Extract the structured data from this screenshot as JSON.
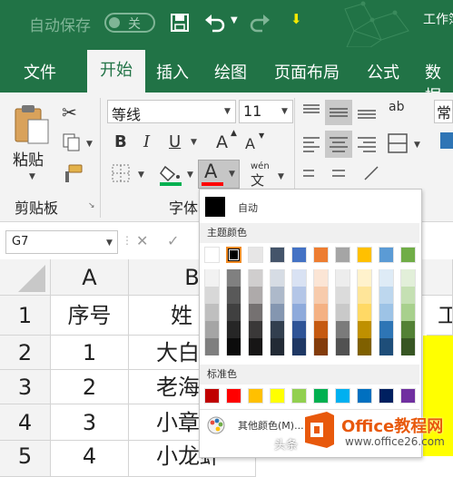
{
  "titlebar": {
    "autosave_label": "自动保存",
    "autosave_state": "关",
    "window_title": "工作簿"
  },
  "tabs": [
    "文件",
    "开始",
    "插入",
    "绘图",
    "页面布局",
    "公式",
    "数据"
  ],
  "active_tab": "开始",
  "ribbon": {
    "paste_label": "粘贴",
    "clipboard_group": "剪贴板",
    "font_group": "字体",
    "font_name": "等线",
    "font_size": "11",
    "bold": "B",
    "italic": "I",
    "underline": "U",
    "grow_font": "A",
    "shrink_font": "A",
    "font_color_glyph": "A",
    "phonetic_top": "wén",
    "phonetic_bottom": "文",
    "orientation_glyph": "ab",
    "number_format_partial": "常"
  },
  "formula_bar": {
    "name_box": "G7",
    "cancel": "✕",
    "confirm": "✓"
  },
  "sheet": {
    "column_headers": [
      "A",
      "B"
    ],
    "row_headers": [
      "1",
      "2",
      "3",
      "4",
      "5"
    ],
    "col_a": [
      "序号",
      "1",
      "2",
      "3",
      "4"
    ],
    "col_b": [
      "姓",
      "大白",
      "老海",
      "小章",
      "小龙虾"
    ],
    "col_f_partial": "工"
  },
  "color_menu": {
    "auto_label": "自动",
    "theme_label": "主题颜色",
    "standard_label": "标准色",
    "more_colors_label": "其他颜色(M)...",
    "theme_top": [
      "#FFFFFF",
      "#000000",
      "#E7E6E6",
      "#44546A",
      "#4472C4",
      "#ED7D31",
      "#A5A5A5",
      "#FFC000",
      "#5B9BD5",
      "#70AD47"
    ],
    "theme_tints": [
      [
        "#F2F2F2",
        "#808080",
        "#D0CECE",
        "#D6DCE4",
        "#D9E2F3",
        "#FBE5D5",
        "#EDEDED",
        "#FFF2CC",
        "#DEEBF6",
        "#E2EFD9"
      ],
      [
        "#D8D8D8",
        "#595959",
        "#AEAAAA",
        "#ADB9CA",
        "#B4C6E7",
        "#F7CBAC",
        "#DBDBDB",
        "#FEE599",
        "#BDD7EE",
        "#C5E0B3"
      ],
      [
        "#BFBFBF",
        "#404040",
        "#757171",
        "#8496B0",
        "#8EAADB",
        "#F4B183",
        "#C9C9C9",
        "#FFD965",
        "#9DC3E6",
        "#A8D08D"
      ],
      [
        "#A5A5A5",
        "#262626",
        "#3A3838",
        "#323F4F",
        "#2F5496",
        "#C55A11",
        "#7B7B7B",
        "#BF9000",
        "#2E75B5",
        "#538135"
      ],
      [
        "#7F7F7F",
        "#0C0C0C",
        "#171616",
        "#222A35",
        "#1F3864",
        "#833C0B",
        "#525252",
        "#7F6000",
        "#1E4E79",
        "#375623"
      ]
    ],
    "standard": [
      "#C00000",
      "#FF0000",
      "#FFC000",
      "#FFFF00",
      "#92D050",
      "#00B050",
      "#00B0F0",
      "#0070C0",
      "#002060",
      "#7030A0"
    ],
    "selected_swatch": "#000000"
  },
  "watermark": {
    "brand": "Office教程网",
    "url": "www.office26.com",
    "source": "头条"
  },
  "colors": {
    "excel_green": "#217346",
    "font_color_underline": "#FF0000",
    "fill_color_underline": "#00B050",
    "highlight_yellow": "#FFFF00"
  }
}
